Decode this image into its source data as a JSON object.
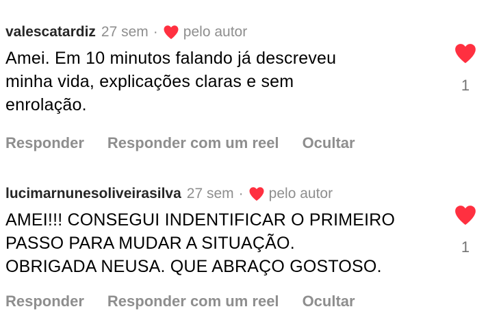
{
  "comments": [
    {
      "username": "valescatardiz",
      "time": "27 sem",
      "separator": "·",
      "by_author": "pelo autor",
      "text": "Amei. Em 10 minutos falando já descreveu\nminha vida, explicações claras e sem\nenrolação.",
      "like_count": "1",
      "actions": [
        "Responder",
        "Responder com um reel",
        "Ocultar"
      ]
    },
    {
      "username": "lucimarnunesoliveirasilva",
      "time": "27 sem",
      "separator": "·",
      "by_author": "pelo autor",
      "text": "AMEI!!! CONSEGUI INDENTIFICAR O PRIMEIRO\nPASSO PARA  MUDAR A SITUAÇÃO.\nOBRIGADA  NEUSA. QUE ABRAÇO  GOSTOSO.",
      "like_count": "1",
      "actions": [
        "Responder",
        "Responder com um reel",
        "Ocultar"
      ]
    }
  ],
  "icons": {
    "author_like": "heart-filled-icon",
    "like": "heart-filled-icon"
  },
  "colors": {
    "heart": "#ff3040",
    "secondary_text": "#8e8e8e",
    "username": "#262626"
  }
}
